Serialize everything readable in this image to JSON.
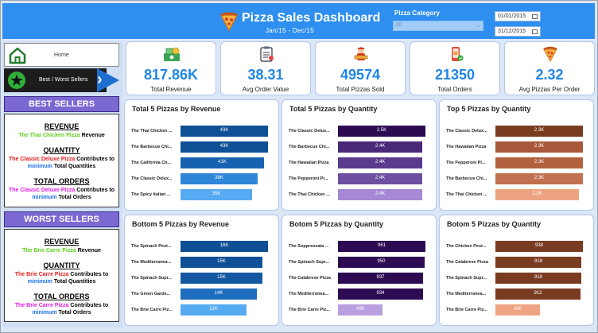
{
  "header": {
    "title": "Pizza Sales Dashboard",
    "subtitle": "Jan/15  -  Dec/15",
    "category_label": "Pizza Category",
    "category_value": "All",
    "date_start": "01/01/2015",
    "date_end": "31/12/2015"
  },
  "nav": {
    "home_label": "Home",
    "best_worst_label": "Best / Worst Sellers"
  },
  "best_sellers": {
    "title": "BEST SELLERS",
    "revenue_head": "REVENUE",
    "revenue_pizza": "The Thai Chicken Pizza",
    "revenue_tail": "Revenue",
    "quantity_head": "QUANTITY",
    "quantity_pizza": "The Classic Deluxe Pizza",
    "quantity_mid": "Contributes to",
    "quantity_min": "minimum",
    "quantity_tail": "Total Quantities",
    "orders_head": "TOTAL ORDERS",
    "orders_pizza": "The Classic Deluxe Pizza",
    "orders_mid": "Contributes to",
    "orders_min": "minimum",
    "orders_tail": "Total Orders"
  },
  "worst_sellers": {
    "title": "WORST SELLERS",
    "revenue_head": "REVENUE",
    "revenue_pizza": "The Brie Carre Pizza",
    "revenue_tail": "Revenue",
    "quantity_head": "QUANTITY",
    "quantity_pizza": "The Brie Carre Pizza",
    "quantity_mid": "Contributes to",
    "quantity_min": "minimum",
    "quantity_tail": "Total Quantities",
    "orders_head": "TOTAL ORDERS",
    "orders_pizza": "The Brie Carre Pizza",
    "orders_mid": "Contributes to",
    "orders_min": "minimum",
    "orders_tail": "Total Orders"
  },
  "kpis": [
    {
      "value": "817.86K",
      "label": "Total Revenue",
      "icon": "money-icon"
    },
    {
      "value": "38.31",
      "label": "Avg Order Value",
      "icon": "clipboard-icon"
    },
    {
      "value": "49574",
      "label": "Total Pizzas Sold",
      "icon": "delivery-person-icon"
    },
    {
      "value": "21350",
      "label": "Total Orders",
      "icon": "phone-order-icon"
    },
    {
      "value": "2.32",
      "label": "Avg Pizzas Per Order",
      "icon": "pizza-slice-icon"
    }
  ],
  "chart_data": [
    {
      "type": "bar",
      "title": "Total 5 Pizzas by Revenue",
      "categories": [
        "The Thai Chicken ...",
        "The Barbecue Chi...",
        "The California Ch...",
        "The Classic Delux...",
        "The Spicy Italian ..."
      ],
      "values": [
        43,
        43,
        41,
        38,
        35
      ],
      "labels": [
        "43K",
        "43K",
        "41K",
        "38K",
        "35K"
      ],
      "colors": [
        "#0e4f96",
        "#0e4f96",
        "#1763b2",
        "#2f86d9",
        "#56aaf1"
      ]
    },
    {
      "type": "bar",
      "title": "Total 5 Pizzas by Quantity",
      "categories": [
        "The Classic Delux...",
        "The Barbecue Chi...",
        "The Hawaiian Pizza",
        "The Pepperoni Pi...",
        "The Thai Chicken ..."
      ],
      "values": [
        2.5,
        2.4,
        2.4,
        2.4,
        2.4
      ],
      "labels": [
        "2.5K",
        "2.4K",
        "2.4K",
        "2.4K",
        "2.4K"
      ],
      "colors": [
        "#2d0b52",
        "#4a2878",
        "#5a3a8c",
        "#6d4fa0",
        "#a688d4"
      ]
    },
    {
      "type": "bar",
      "title": "Top 5 Pizzas by Quantity",
      "categories": [
        "The Classic Delux...",
        "The Hawaiian Pizza",
        "The Pepperoni Pi...",
        "The Barbecue Chi...",
        "The Thai Chicken ..."
      ],
      "values": [
        2.3,
        2.3,
        2.3,
        2.3,
        2.2
      ],
      "labels": [
        "2.3K",
        "2.3K",
        "2.3K",
        "2.3K",
        "2.2K"
      ],
      "colors": [
        "#7a3c21",
        "#a8583a",
        "#b2623f",
        "#c1714f",
        "#eea482"
      ]
    },
    {
      "type": "bar",
      "title": "Bottom 5 Pizzas by Revenue",
      "categories": [
        "The Spinach Pest...",
        "The Mediterranea...",
        "The Spinach Supr...",
        "The Green Garde...",
        "The Brie Carre Piz..."
      ],
      "values": [
        16,
        15,
        15,
        14,
        12
      ],
      "labels": [
        "16K",
        "15K",
        "15K",
        "14K",
        "12K"
      ],
      "colors": [
        "#0e4f96",
        "#0e4f96",
        "#1458a2",
        "#1e6dbe",
        "#56aaf1"
      ]
    },
    {
      "type": "bar",
      "title": "Botom 5 Pizzas by Quantity",
      "categories": [
        "The Soppressata ...",
        "The Spinach Supr...",
        "The Calabrese Pizza",
        "The Mediterranea...",
        "The Brie Carre Piz..."
      ],
      "values": [
        961,
        950,
        937,
        934,
        490
      ],
      "labels": [
        "961",
        "950",
        "937",
        "934",
        "490"
      ],
      "colors": [
        "#2d0b52",
        "#2d0b52",
        "#2d0b52",
        "#2d0b52",
        "#b99fe0"
      ]
    },
    {
      "type": "bar",
      "title": "Botom 5 Pizzas by Quantity",
      "categories": [
        "The Chicken Pest...",
        "The Calabrese Pizza",
        "The Spinach Supr...",
        "The Mediterranea...",
        "The Brie Carre Piz..."
      ],
      "values": [
        938,
        918,
        918,
        912,
        480
      ],
      "labels": [
        "938",
        "918",
        "918",
        "912",
        "480"
      ],
      "colors": [
        "#7a3c21",
        "#7a3c21",
        "#7a3c21",
        "#7a3c21",
        "#eea482"
      ]
    }
  ]
}
